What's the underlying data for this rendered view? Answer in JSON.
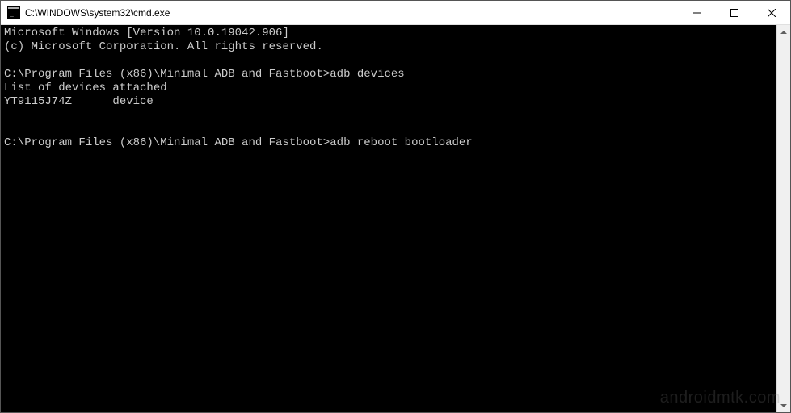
{
  "titlebar": {
    "icon_name": "cmd-icon",
    "title": "C:\\WINDOWS\\system32\\cmd.exe"
  },
  "window_controls": {
    "minimize": "minimize",
    "maximize": "maximize",
    "close": "close"
  },
  "terminal": {
    "lines": [
      "Microsoft Windows [Version 10.0.19042.906]",
      "(c) Microsoft Corporation. All rights reserved.",
      "",
      "C:\\Program Files (x86)\\Minimal ADB and Fastboot>adb devices",
      "List of devices attached",
      "YT9115J74Z      device",
      "",
      "",
      "C:\\Program Files (x86)\\Minimal ADB and Fastboot>adb reboot bootloader"
    ]
  },
  "watermark": "androidmtk.com"
}
